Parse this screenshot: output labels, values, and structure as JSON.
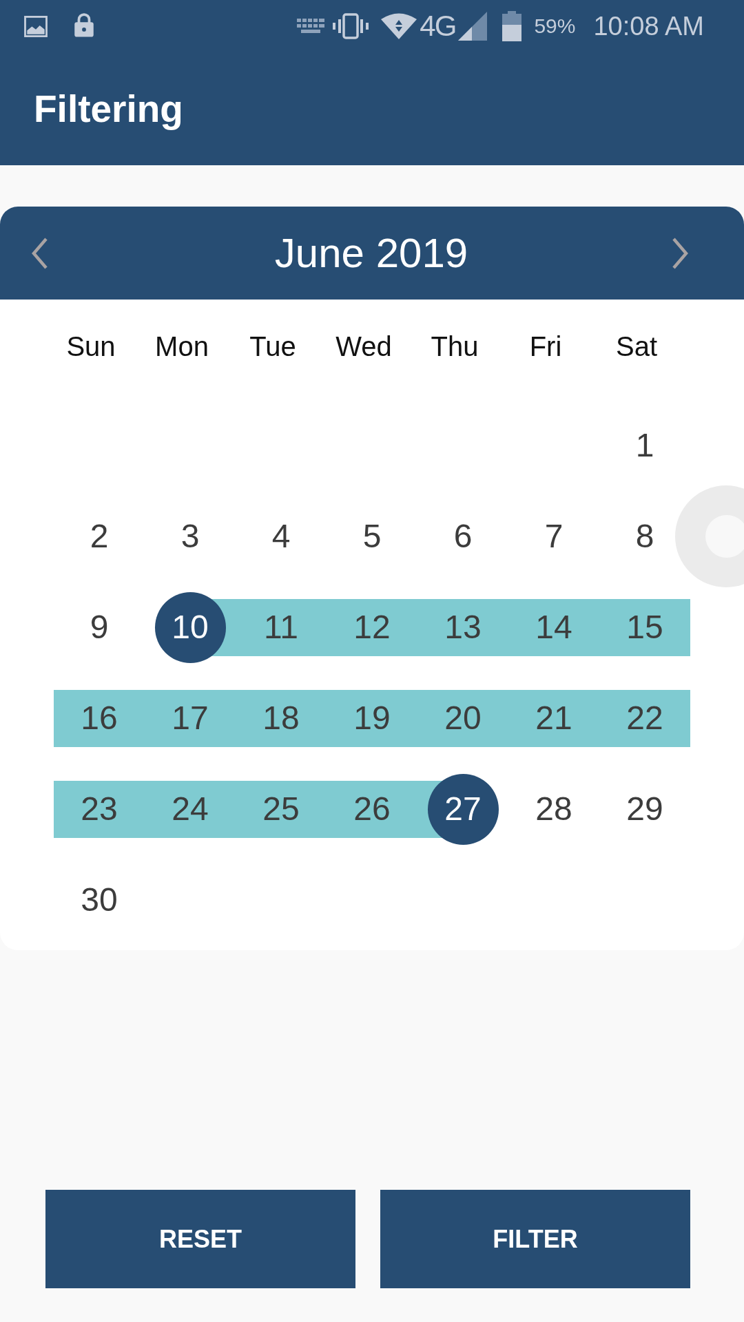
{
  "status_bar": {
    "network": "4G",
    "battery": "59%",
    "time": "10:08 AM"
  },
  "app_bar": {
    "title": "Filtering"
  },
  "calendar": {
    "month": "June 2019",
    "weekdays": [
      "Sun",
      "Mon",
      "Tue",
      "Wed",
      "Thu",
      "Fri",
      "Sat"
    ],
    "weeks": [
      [
        {
          "day": "1",
          "selected": false,
          "in_range": false
        }
      ],
      [
        {
          "day": "2",
          "selected": false,
          "in_range": false
        },
        {
          "day": "3",
          "selected": false,
          "in_range": false
        },
        {
          "day": "4",
          "selected": false,
          "in_range": false
        },
        {
          "day": "5",
          "selected": false,
          "in_range": false
        },
        {
          "day": "6",
          "selected": false,
          "in_range": false
        },
        {
          "day": "7",
          "selected": false,
          "in_range": false
        },
        {
          "day": "8",
          "selected": false,
          "in_range": false
        }
      ],
      [
        {
          "day": "9",
          "selected": false,
          "in_range": false
        },
        {
          "day": "10",
          "selected": true,
          "in_range": true
        },
        {
          "day": "11",
          "selected": false,
          "in_range": true
        },
        {
          "day": "12",
          "selected": false,
          "in_range": true
        },
        {
          "day": "13",
          "selected": false,
          "in_range": true
        },
        {
          "day": "14",
          "selected": false,
          "in_range": true
        },
        {
          "day": "15",
          "selected": false,
          "in_range": true
        }
      ],
      [
        {
          "day": "16",
          "selected": false,
          "in_range": true
        },
        {
          "day": "17",
          "selected": false,
          "in_range": true
        },
        {
          "day": "18",
          "selected": false,
          "in_range": true
        },
        {
          "day": "19",
          "selected": false,
          "in_range": true
        },
        {
          "day": "20",
          "selected": false,
          "in_range": true
        },
        {
          "day": "21",
          "selected": false,
          "in_range": true
        },
        {
          "day": "22",
          "selected": false,
          "in_range": true
        }
      ],
      [
        {
          "day": "23",
          "selected": false,
          "in_range": true
        },
        {
          "day": "24",
          "selected": false,
          "in_range": true
        },
        {
          "day": "25",
          "selected": false,
          "in_range": true
        },
        {
          "day": "26",
          "selected": false,
          "in_range": true
        },
        {
          "day": "27",
          "selected": true,
          "in_range": true
        },
        {
          "day": "28",
          "selected": false,
          "in_range": false
        },
        {
          "day": "29",
          "selected": false,
          "in_range": false
        }
      ],
      [
        {
          "day": "30",
          "selected": false,
          "in_range": false
        }
      ]
    ]
  },
  "buttons": [
    {
      "label": "RESET"
    },
    {
      "label": "FILTER"
    }
  ]
}
